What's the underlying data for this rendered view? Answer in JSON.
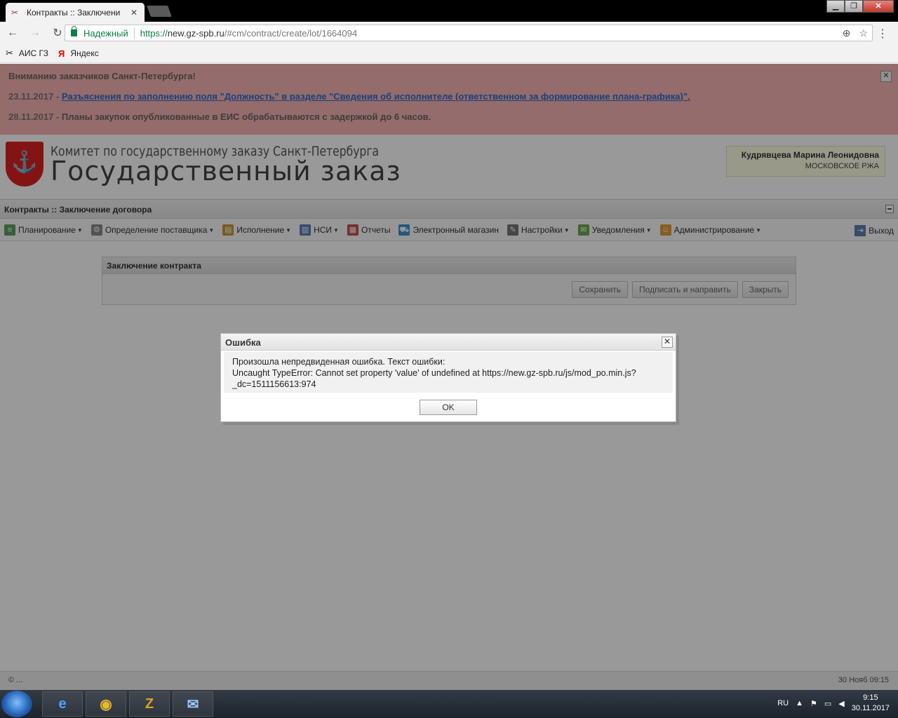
{
  "browser": {
    "tab_title": "Контракты :: Заключени",
    "secure_label": "Надежный",
    "url_scheme": "https://",
    "url_host": "new.gz-spb.ru",
    "url_path": "/#cm/contract/create/lot/1664094"
  },
  "bookmarks": [
    {
      "label": "АИС ГЗ",
      "icon": "tools-icon"
    },
    {
      "label": "Яндекс",
      "icon": "yandex-icon"
    }
  ],
  "announcement": {
    "title": "Вниманию заказчиков Санкт-Петербурга!",
    "items": [
      {
        "date": "23.11.2017 - ",
        "text": "Разъяснения по заполнению поля \"Должность\" в разделе \"Сведения об исполнителе (ответственном за формирование плана-графика)\"."
      },
      {
        "date": "28.11.2017 - ",
        "text": "Планы закупок опубликованные в ЕИС обрабатываются с задержкой до 6 часов."
      }
    ]
  },
  "header": {
    "brand_line1": "Комитет по государственному заказу Санкт-Петербурга",
    "brand_line2": "Государственный заказ",
    "user_name": "Кудрявцева Марина Леонидовна",
    "user_org": "МОСКОВСКОЕ РЖА"
  },
  "page_title": "Контракты :: Заключение договора",
  "menu": [
    {
      "label": "Планирование",
      "dropdown": true,
      "color": "#5aa25a"
    },
    {
      "label": "Определение поставщика",
      "dropdown": true,
      "color": "#8a8a8a"
    },
    {
      "label": "Исполнение",
      "dropdown": true,
      "color": "#c49a3a"
    },
    {
      "label": "НСИ",
      "dropdown": true,
      "color": "#5b7fb5"
    },
    {
      "label": "Отчеты",
      "dropdown": false,
      "color": "#c0504d"
    },
    {
      "label": "Электронный магазин",
      "dropdown": false,
      "color": "#3c8fd0"
    },
    {
      "label": "Настройки",
      "dropdown": true,
      "color": "#777777"
    },
    {
      "label": "Уведомления",
      "dropdown": true,
      "color": "#6aa84f"
    },
    {
      "label": "Администрирование",
      "dropdown": true,
      "color": "#e59a3a"
    }
  ],
  "exit_label": "Выход",
  "panel": {
    "title": "Заключение контракта",
    "buttons": [
      "Сохранить",
      "Подписать и направить",
      "Закрыть"
    ]
  },
  "footer": {
    "left": "© ...",
    "right": "30 Нояб 09:15"
  },
  "dialog": {
    "title": "Ошибка",
    "line1": "Произошла непредвиденная ошибка. Текст ошибки:",
    "line2": "Uncaught TypeError: Cannot set property 'value' of undefined at https://new.gz-spb.ru/js/mod_po.min.js?",
    "line3": "_dc=1511156613:974",
    "ok": "OK"
  },
  "taskbar": {
    "lang": "RU",
    "time": "9:15",
    "date": "30.11.2017"
  }
}
